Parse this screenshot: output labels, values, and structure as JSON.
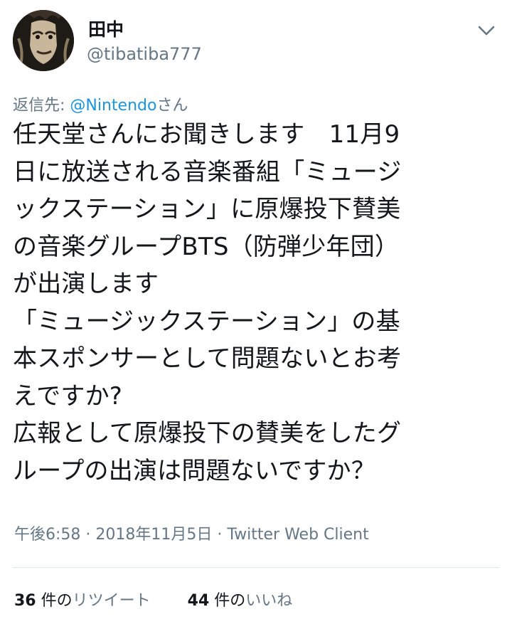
{
  "user": {
    "display_name": "田中",
    "handle": "@tibatiba777"
  },
  "reply": {
    "prefix": "返信先: ",
    "mention": "@Nintendo",
    "suffix": "さん"
  },
  "tweet": {
    "text": "任天堂さんにお聞きします　11月9\n日に放送される音楽番組「ミュージ\nックステーション」に原爆投下賛美\nの音楽グループBTS（防弾少年団）\nが出演します\n「ミュージックステーション」の基\n本スポンサーとして問題ないとお考\nえですか?\n広報として原爆投下の賛美をしたグ\nループの出演は問題ないですか？"
  },
  "meta": {
    "time": "午後6:58",
    "separator1": " · ",
    "date": "2018年11月5日",
    "separator2": " · ",
    "client": "Twitter Web Client"
  },
  "stats": {
    "retweets_count": "36",
    "retweets_suffix": " 件の",
    "retweets_label": "リツイート",
    "likes_count": "44",
    "likes_suffix": " 件の",
    "likes_label": "いいね"
  },
  "colors": {
    "text": "#14171a",
    "secondary": "#657786",
    "link": "#1b95e0",
    "divider": "#e1e8ed"
  },
  "icons": {
    "menu": "chevron-down-icon",
    "avatar": "avatar-image"
  }
}
